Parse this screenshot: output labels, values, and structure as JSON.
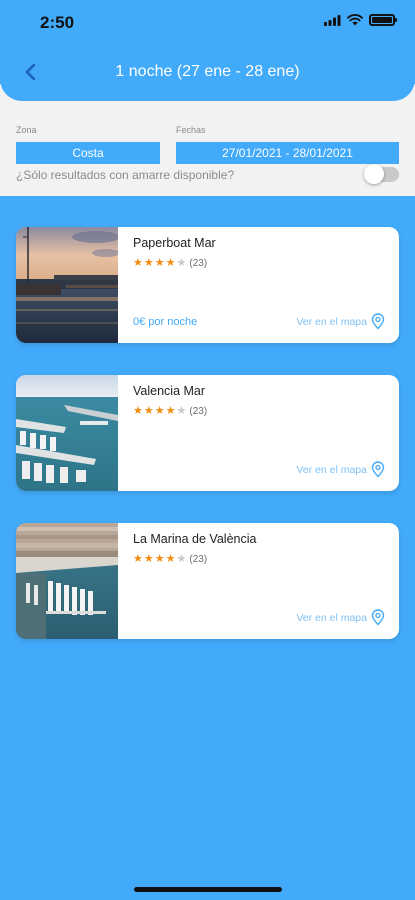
{
  "status_bar": {
    "time": "2:50"
  },
  "header": {
    "title": "1 noche (27 ene - 28 ene)"
  },
  "filters": {
    "zone_label": "Zona",
    "zone_value": "Costa",
    "dates_label": "Fechas",
    "dates_value": "27/01/2021 - 28/01/2021",
    "mooring_question": "¿Sólo resultados con amarre disponible?",
    "mooring_toggle": "off"
  },
  "results": [
    {
      "name": "Paperboat Mar",
      "stars": 4,
      "reviews": "(23)",
      "price": "0€ por noche",
      "map_link": "Ver en el mapa"
    },
    {
      "name": "Valencia Mar",
      "stars": 4,
      "reviews": "(23)",
      "price": "",
      "map_link": "Ver en el mapa"
    },
    {
      "name": "La Marina de València",
      "stars": 4,
      "reviews": "(23)",
      "price": "",
      "map_link": "Ver en el mapa"
    }
  ],
  "icons": {
    "back": "chevron-left-icon",
    "signal": "cellular-signal-icon",
    "wifi": "wifi-icon",
    "battery": "battery-icon",
    "map": "map-pin-icon",
    "star": "star-icon"
  },
  "colors": {
    "primary": "#42aafa",
    "star_filled": "#f28c0f",
    "star_empty": "#c8c8c8",
    "panel": "#f2f2f2"
  }
}
